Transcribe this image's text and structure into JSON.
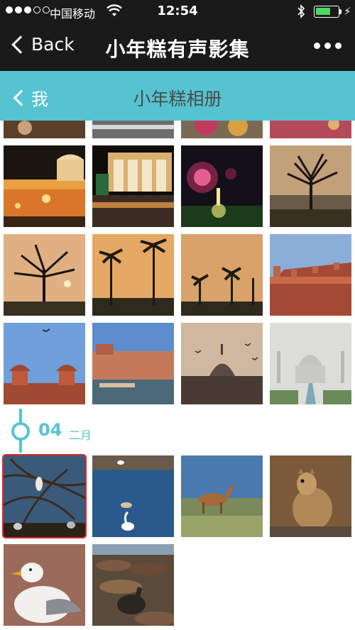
{
  "status_bar": {
    "carrier": "中国移动",
    "time": "12:54",
    "battery_level": 0.65,
    "signal_bars": 3,
    "signal_total": 5
  },
  "nav": {
    "back_label": "Back",
    "title": "小年糕有声影集"
  },
  "album": {
    "back_label": "我",
    "title": "小年糕相册"
  },
  "date_group": {
    "day": "04",
    "month": "二月"
  },
  "photos": [
    {
      "subject": "village at sunset (top, cropped)"
    },
    {
      "subject": "road (top, cropped)"
    },
    {
      "subject": "festival crowd (top, cropped)"
    },
    {
      "subject": "market (top, cropped)"
    },
    {
      "subject": "lit palace wall at night"
    },
    {
      "subject": "lit wedding stage at night"
    },
    {
      "subject": "fireworks at night"
    },
    {
      "subject": "tree silhouette at dusk"
    },
    {
      "subject": "tree silhouette at sunset"
    },
    {
      "subject": "palm trees at sunset"
    },
    {
      "subject": "palm trees at dusk"
    },
    {
      "subject": "red fort"
    },
    {
      "subject": "fort pavilions and blue sky"
    },
    {
      "subject": "fort courtyard with pool"
    },
    {
      "subject": "domed mosque with birds"
    },
    {
      "subject": "taj mahal in mist"
    },
    {
      "subject": "heron on branches"
    },
    {
      "subject": "ducks and swan on lake"
    },
    {
      "subject": "deer on grass"
    },
    {
      "subject": "squirrel"
    },
    {
      "subject": "seagull"
    },
    {
      "subject": "sea lions"
    }
  ],
  "colors": {
    "accent": "#56c3d1",
    "selection": "#e0262b",
    "nav_bg": "#1a1a1a"
  }
}
